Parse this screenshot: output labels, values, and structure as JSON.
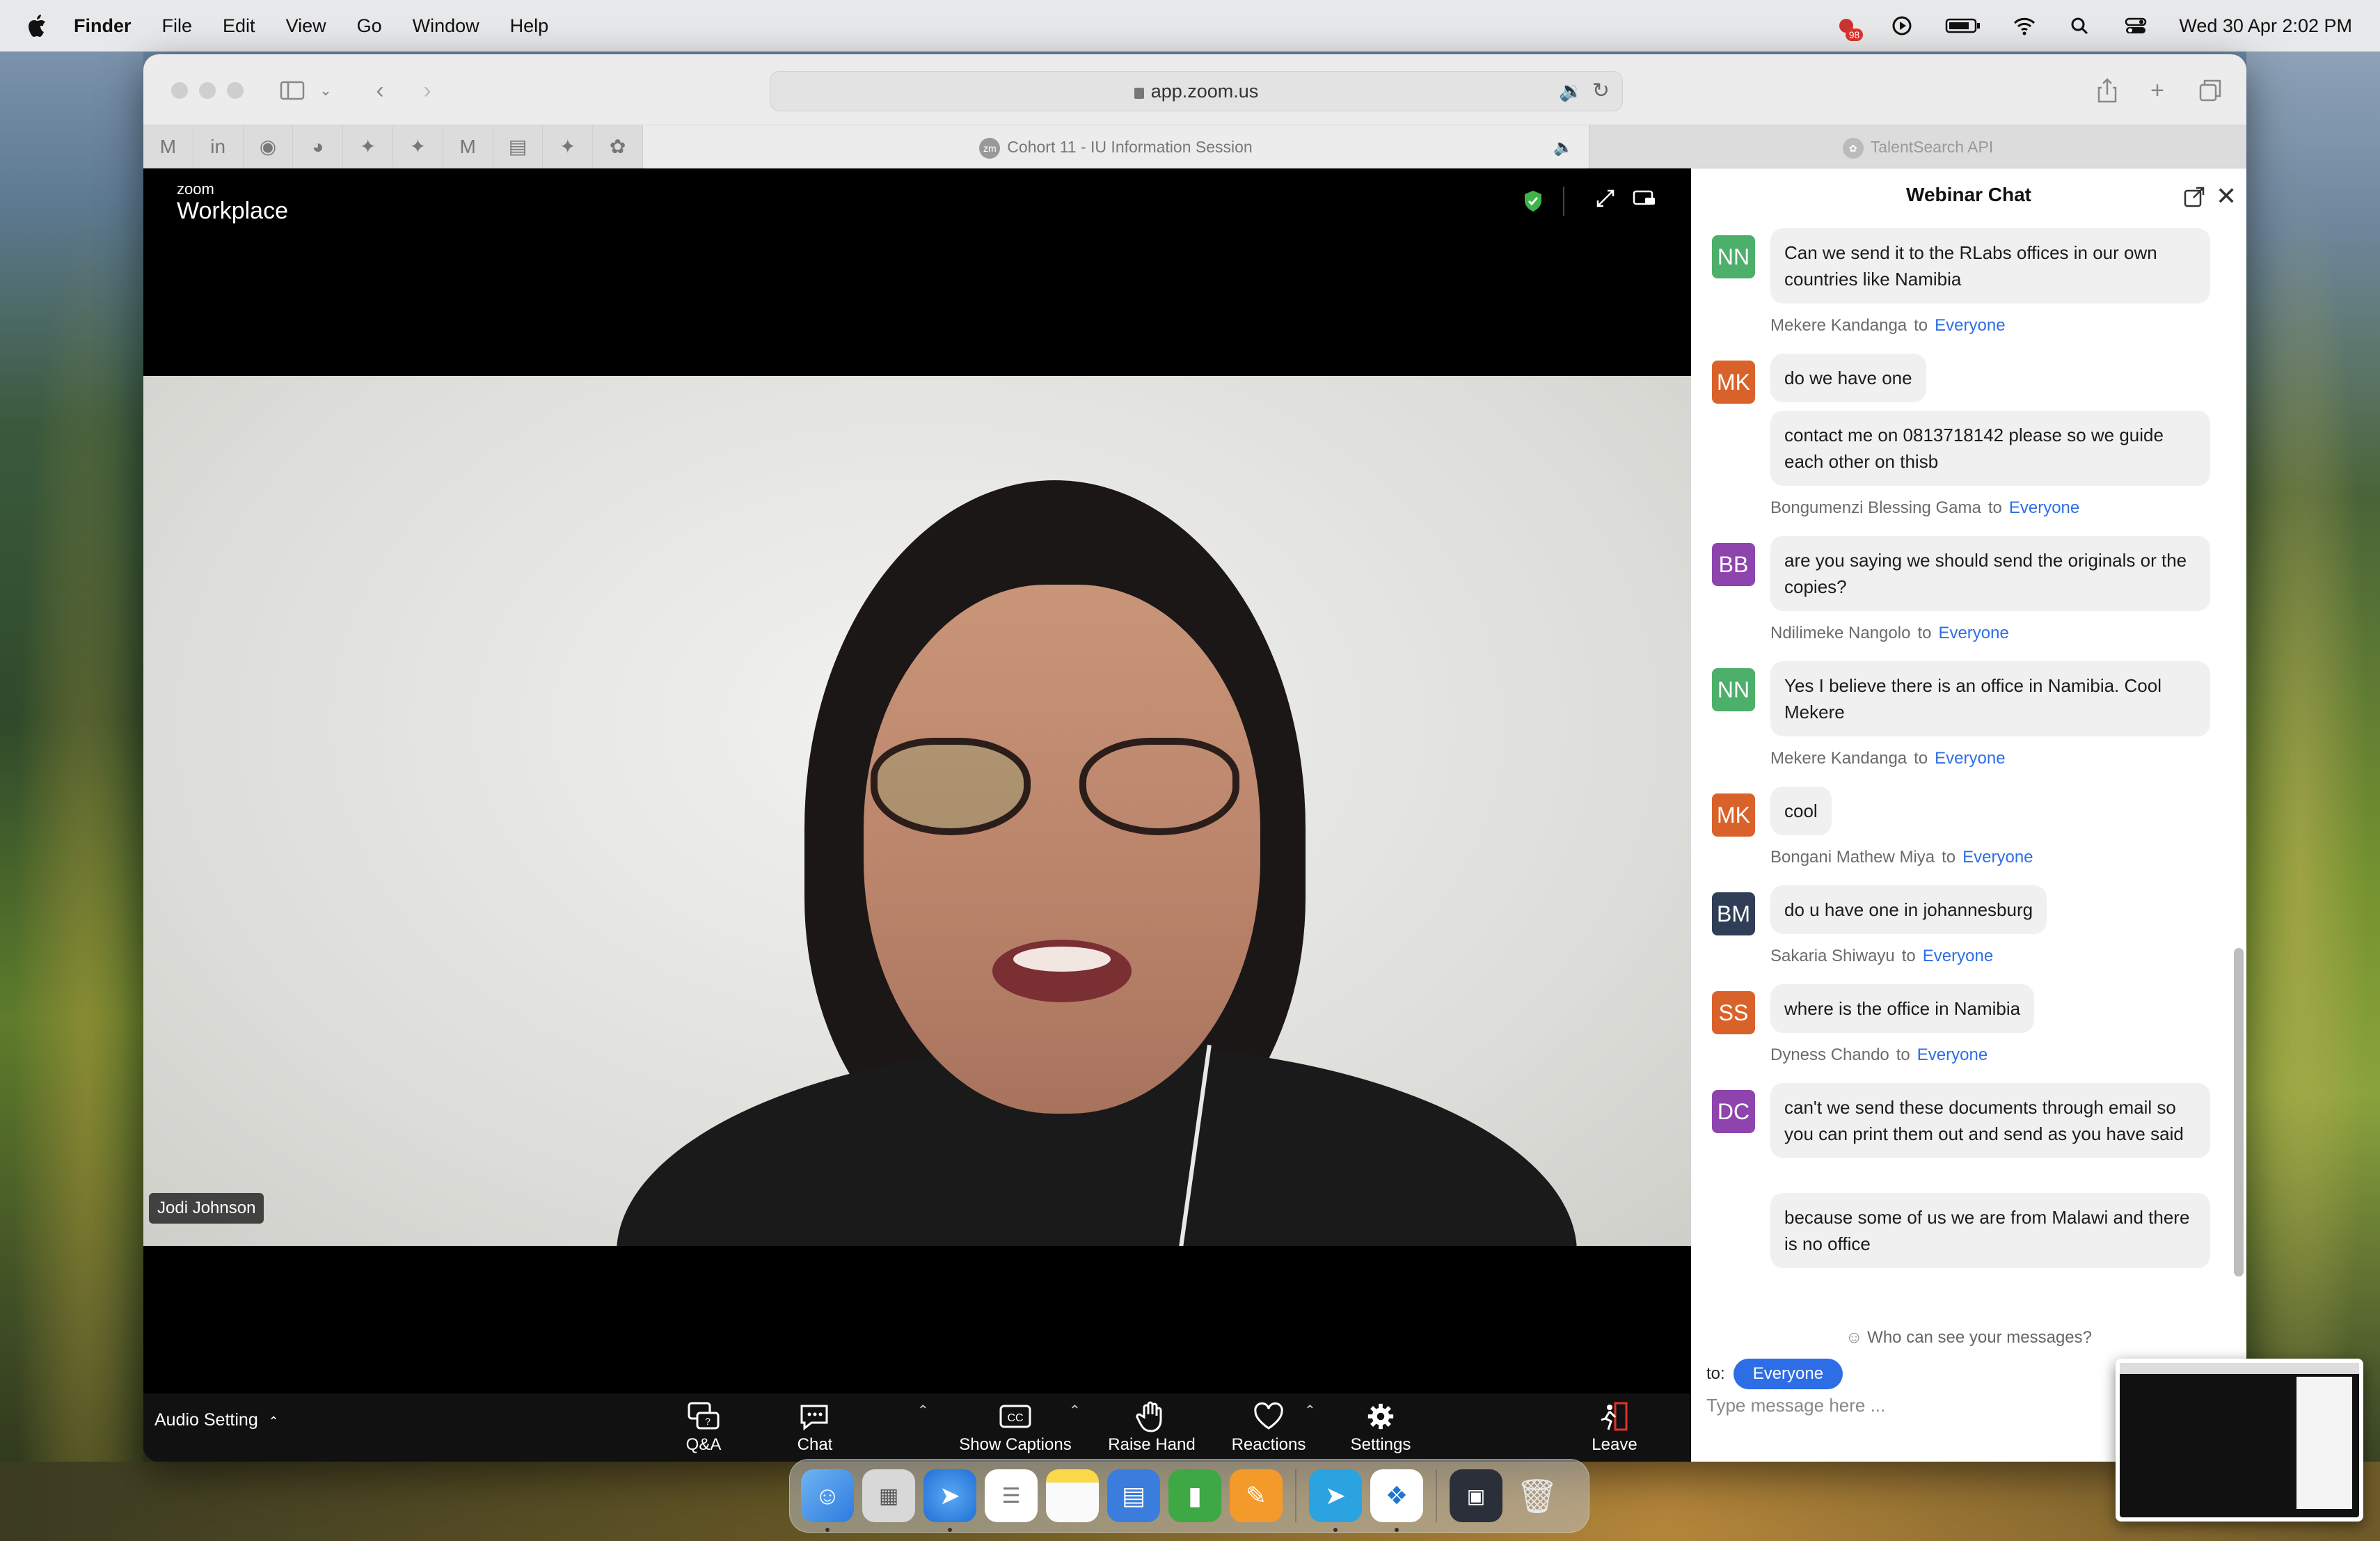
{
  "menubar": {
    "app_name": "Finder",
    "menus": [
      "File",
      "Edit",
      "View",
      "Go",
      "Window",
      "Help"
    ],
    "notification_badge": "98",
    "clock": "Wed 30 Apr  2:02 PM"
  },
  "browser": {
    "url": "app.zoom.us",
    "tabs": {
      "active": "Cohort 11 - IU Information Session",
      "other": "TalentSearch API"
    }
  },
  "zoom": {
    "logo_small": "zoom",
    "logo_big": "Workplace",
    "participant_name": "Jodi Johnson",
    "audio_setting": "Audio Setting",
    "controls": [
      {
        "label": "Q&A",
        "icon": "qa-icon"
      },
      {
        "label": "Chat",
        "icon": "chat-icon"
      },
      {
        "label": "Show Captions",
        "icon": "captions-icon"
      },
      {
        "label": "Raise Hand",
        "icon": "hand-icon"
      },
      {
        "label": "Reactions",
        "icon": "heart-icon"
      },
      {
        "label": "Settings",
        "icon": "gear-icon"
      },
      {
        "label": "Leave",
        "icon": "leave-icon"
      }
    ],
    "colors": {
      "accent": "#2d6ee6",
      "leave": "#e0322c",
      "secure": "#3fb24a"
    }
  },
  "chat": {
    "title": "Webinar Chat",
    "items": [
      {
        "type": "message",
        "avatar": "NN",
        "avatar_color": "#4caf6a",
        "text": "Can we send  it to the RLabs offices in our own countries like Namibia"
      },
      {
        "type": "sender",
        "name": "Mekere Kandanga",
        "to": "to",
        "recipient": "Everyone"
      },
      {
        "type": "message",
        "avatar": "MK",
        "avatar_color": "#d9622b",
        "text": "do we have one"
      },
      {
        "type": "message",
        "avatar": "",
        "text": "contact me on 0813718142 please so we guide each other on thisb"
      },
      {
        "type": "sender",
        "name": "Bongumenzi Blessing Gama",
        "to": "to",
        "recipient": "Everyone"
      },
      {
        "type": "message",
        "avatar": "BB",
        "avatar_color": "#8e44ad",
        "text": "are you saying we should send the originals or the copies?"
      },
      {
        "type": "sender",
        "name": "Ndilimeke Nangolo",
        "to": "to",
        "recipient": "Everyone"
      },
      {
        "type": "message",
        "avatar": "NN",
        "avatar_color": "#4caf6a",
        "text": "Yes I believe there is an office in Namibia. Cool Mekere"
      },
      {
        "type": "sender",
        "name": "Mekere Kandanga",
        "to": "to",
        "recipient": "Everyone"
      },
      {
        "type": "message",
        "avatar": "MK",
        "avatar_color": "#d9622b",
        "text": "cool"
      },
      {
        "type": "sender",
        "name": "Bongani Mathew Miya",
        "to": "to",
        "recipient": "Everyone"
      },
      {
        "type": "message",
        "avatar": "BM",
        "avatar_color": "#2f3e56",
        "text": "do u have one in johannesburg"
      },
      {
        "type": "sender",
        "name": "Sakaria Shiwayu",
        "to": "to",
        "recipient": "Everyone"
      },
      {
        "type": "message",
        "avatar": "SS",
        "avatar_color": "#d9622b",
        "text": "where is the office in Namibia"
      },
      {
        "type": "sender",
        "name": "Dyness Chando",
        "to": "to",
        "recipient": "Everyone"
      },
      {
        "type": "message",
        "avatar": "DC",
        "avatar_color": "#8e44ad",
        "text": "can't we send these documents through email so you can print them out and send as you have said"
      },
      {
        "type": "message",
        "avatar": "",
        "text": "because some of us we are from Malawi and there is no office"
      }
    ],
    "who_can_see": "Who can see your messages?",
    "to_label": "to:",
    "recipient": "Everyone",
    "input_placeholder": "Type message here ..."
  }
}
